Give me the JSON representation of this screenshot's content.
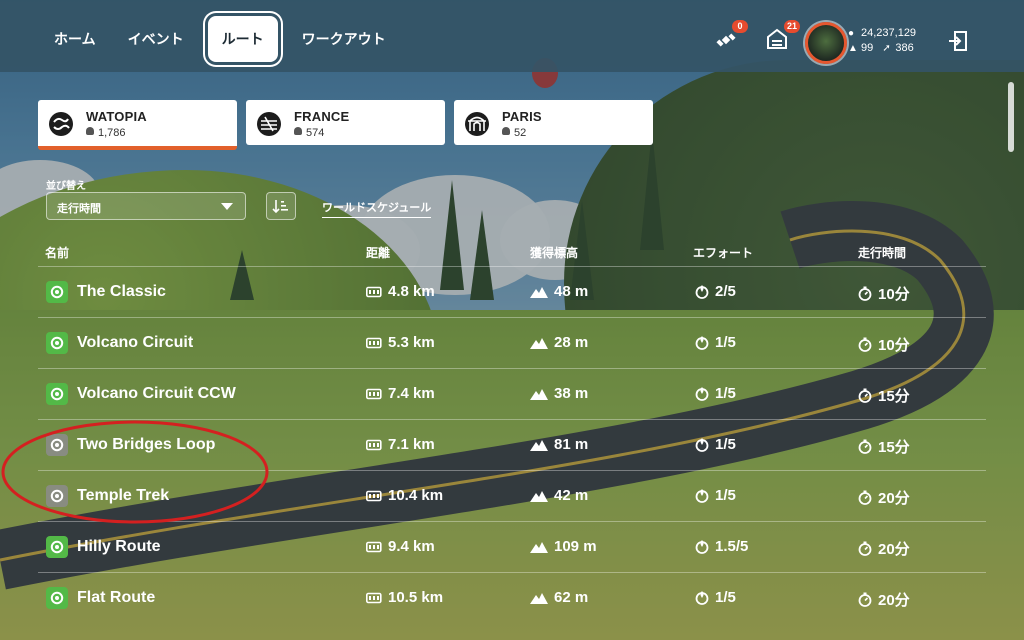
{
  "nav": {
    "tabs": [
      {
        "label": "ホーム"
      },
      {
        "label": "イベント"
      },
      {
        "label": "ルート"
      },
      {
        "label": "ワークアウト"
      }
    ],
    "active_index": 2
  },
  "topbar": {
    "satellite_badge": "0",
    "home_badge": "21",
    "stat_drops": "24,237,129",
    "stat_level": "99",
    "stat_ride": "386",
    "icons": [
      "satellite-icon",
      "garage-icon",
      "drop-icon",
      "level-icon",
      "ride-icon",
      "exit-icon"
    ]
  },
  "worlds": [
    {
      "name": "WATOPIA",
      "count": "1,786",
      "icon": "watopia-logo"
    },
    {
      "name": "FRANCE",
      "count": "574",
      "icon": "france-logo"
    },
    {
      "name": "PARIS",
      "count": "52",
      "icon": "paris-logo"
    }
  ],
  "sort": {
    "label": "並び替え",
    "value": "走行時間",
    "schedule_link": "ワールドスケジュール"
  },
  "table": {
    "headers": {
      "name": "名前",
      "distance": "距離",
      "elevation": "獲得標高",
      "effort": "エフォート",
      "time": "走行時間"
    },
    "rows": [
      {
        "name": "The Classic",
        "distance": "4.8 km",
        "elevation": "48 m",
        "effort": "2/5",
        "time": "10分",
        "completed": true
      },
      {
        "name": "Volcano Circuit",
        "distance": "5.3 km",
        "elevation": "28 m",
        "effort": "1/5",
        "time": "10分",
        "completed": true
      },
      {
        "name": "Volcano Circuit CCW",
        "distance": "7.4 km",
        "elevation": "38 m",
        "effort": "1/5",
        "time": "15分",
        "completed": true
      },
      {
        "name": "Two Bridges Loop",
        "distance": "7.1 km",
        "elevation": "81 m",
        "effort": "1/5",
        "time": "15分",
        "completed": false
      },
      {
        "name": "Temple Trek",
        "distance": "10.4 km",
        "elevation": "42 m",
        "effort": "1/5",
        "time": "20分",
        "completed": false
      },
      {
        "name": "Hilly Route",
        "distance": "9.4 km",
        "elevation": "109 m",
        "effort": "1.5/5",
        "time": "20分",
        "completed": true
      },
      {
        "name": "Flat Route",
        "distance": "10.5 km",
        "elevation": "62 m",
        "effort": "1/5",
        "time": "20分",
        "completed": true
      }
    ]
  },
  "colors": {
    "accent": "#e2602b",
    "completed": "#53b947",
    "annotation": "#d42020"
  }
}
